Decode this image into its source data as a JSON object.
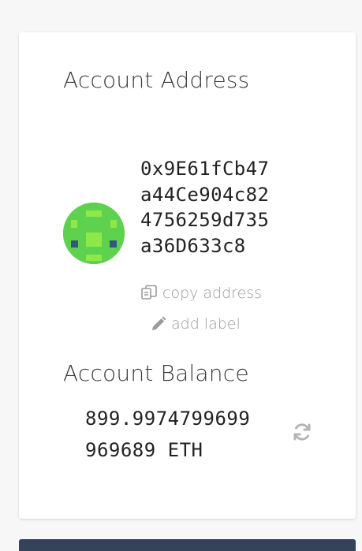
{
  "account": {
    "address_title": "Account Address",
    "address_lines": [
      "0x9E61fCb47",
      "a44Ce904c82",
      "4756259d735",
      "a36D633c8"
    ],
    "copy_label": "copy address",
    "add_label": "add label",
    "balance_title": "Account Balance",
    "balance_lines": [
      "899.9974799699",
      "969689 ETH"
    ]
  },
  "icons": {
    "copy": "copy-icon",
    "pencil": "pencil-icon",
    "refresh": "refresh-icon"
  },
  "colors": {
    "identicon_bg": "#5ed14e",
    "identicon_light": "#8fe84a",
    "identicon_dark": "#33597a",
    "muted": "#9a9a9a",
    "bottom_bar": "#34425a"
  }
}
